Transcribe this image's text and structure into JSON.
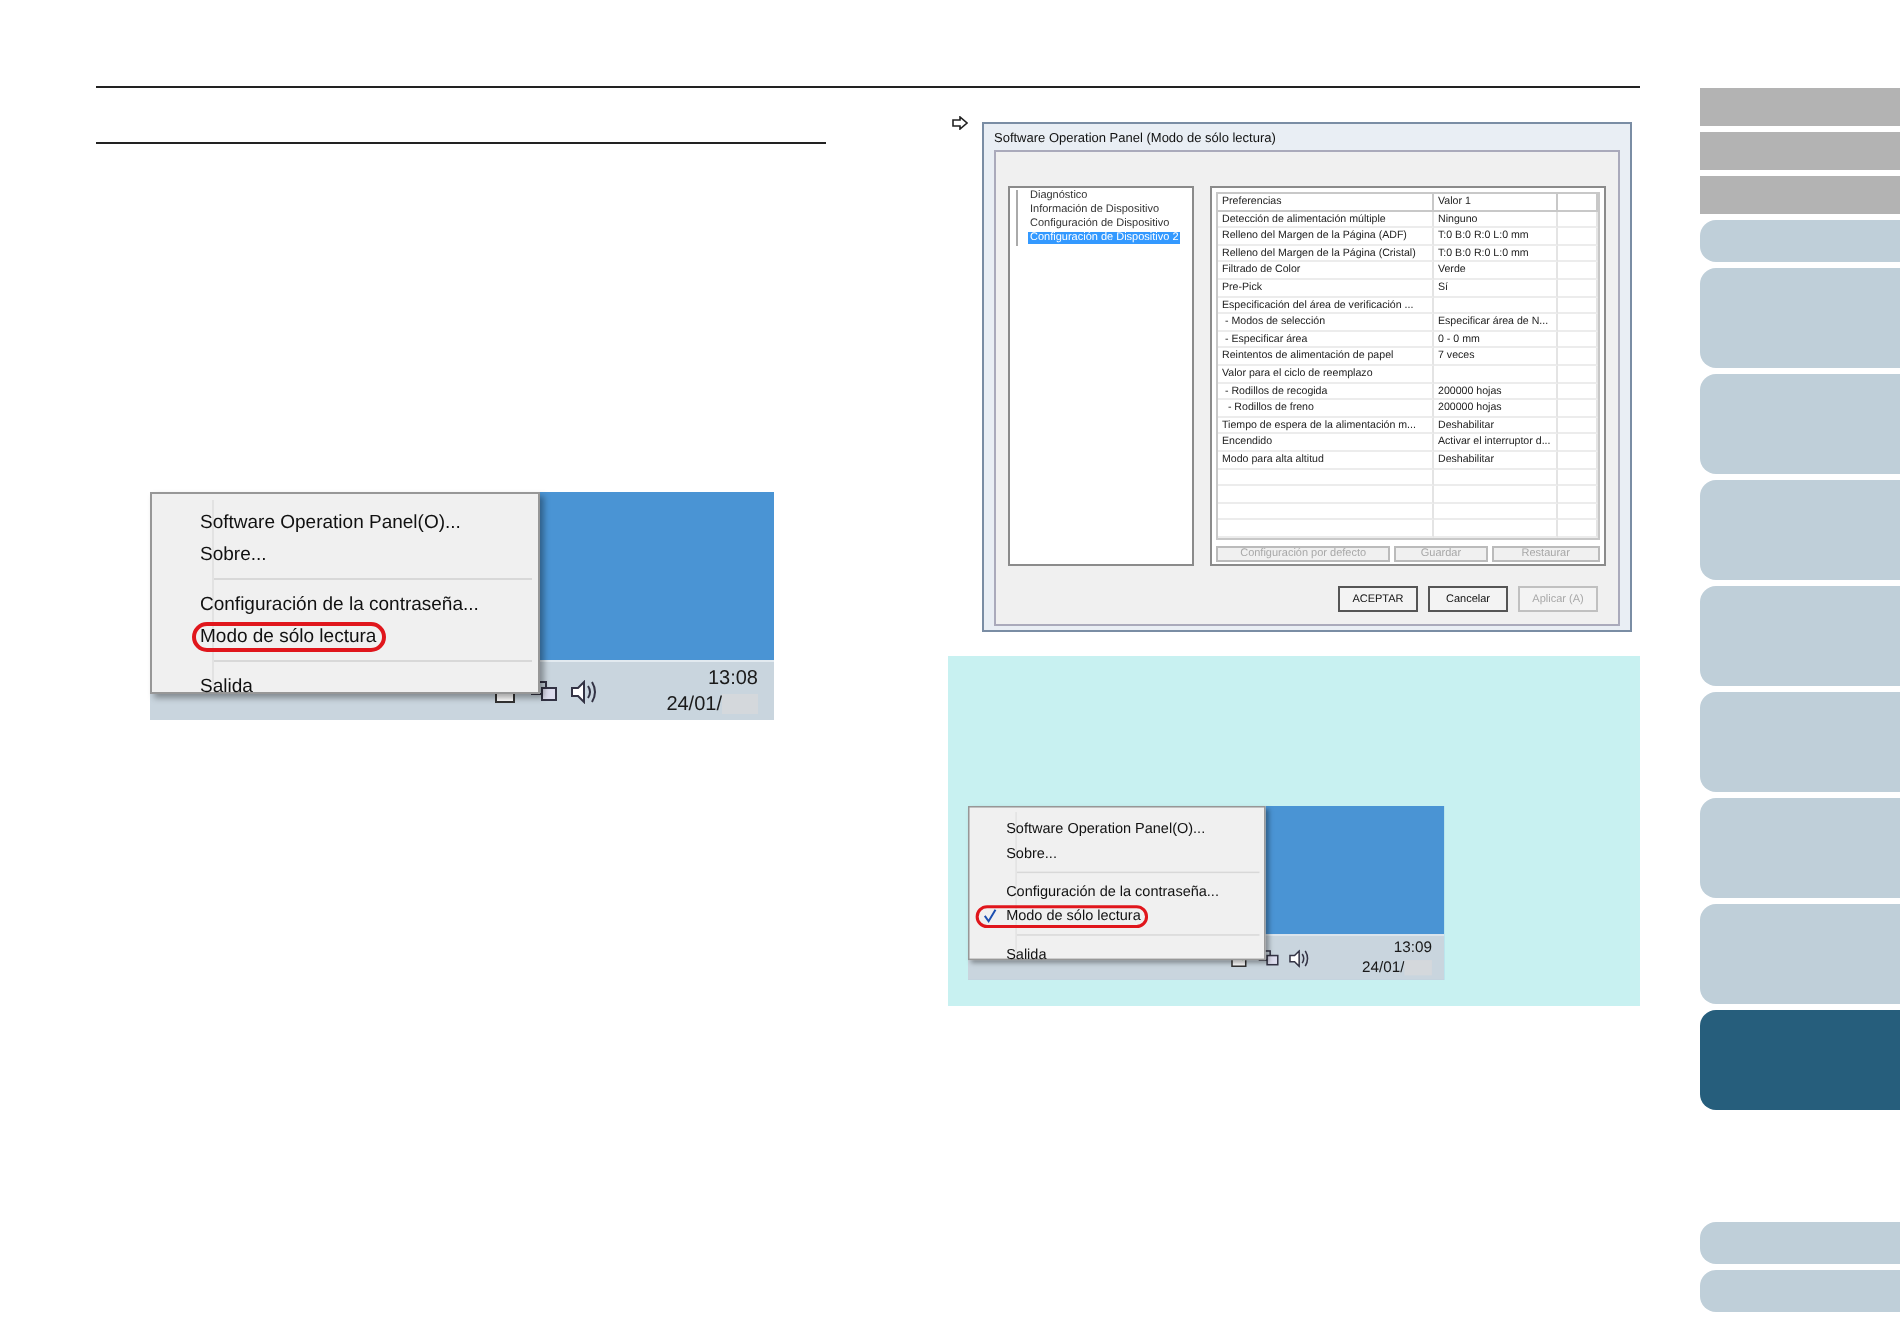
{
  "side_tabs": [
    {
      "kind": "bar",
      "selected": false
    },
    {
      "kind": "bar",
      "selected": false
    },
    {
      "kind": "bar",
      "selected": false
    },
    {
      "kind": "short",
      "selected": false
    },
    {
      "kind": "tall",
      "selected": false
    },
    {
      "kind": "tall",
      "selected": false
    },
    {
      "kind": "tall",
      "selected": false
    },
    {
      "kind": "tall",
      "selected": false
    },
    {
      "kind": "tall",
      "selected": false
    },
    {
      "kind": "tall",
      "selected": false
    },
    {
      "kind": "tall",
      "selected": false
    },
    {
      "kind": "tall",
      "selected": true
    },
    {
      "kind": "foot",
      "selected": false
    },
    {
      "kind": "short",
      "selected": false
    }
  ],
  "menu_screenshot": {
    "menu_groups": [
      [
        {
          "label": "Software Operation Panel(O)...",
          "circled": false,
          "checked": false
        },
        {
          "label": "Sobre...",
          "circled": false,
          "checked": false
        }
      ],
      [
        {
          "label": "Configuración de la contraseña...",
          "circled": false,
          "checked": false
        },
        {
          "label": "Modo de sólo lectura",
          "circled": true,
          "checked": false
        }
      ],
      [
        {
          "label": "Salida",
          "circled": false,
          "checked": false
        }
      ]
    ],
    "time": "13:08",
    "date": "24/01/"
  },
  "dialog": {
    "title": "Software Operation Panel (Modo de sólo lectura)",
    "tree": [
      {
        "label": "Diagnóstico",
        "selected": false
      },
      {
        "label": "Información de Dispositivo",
        "selected": false
      },
      {
        "label": "Configuración de Dispositivo",
        "selected": false
      },
      {
        "label": "Configuración de Dispositivo 2",
        "selected": true
      }
    ],
    "columns": [
      "Preferencias",
      "Valor 1"
    ],
    "rows": [
      [
        "Detección de alimentación múltiple",
        "Ninguno"
      ],
      [
        "Relleno del Margen de la Página (ADF)",
        "T:0 B:0 R:0 L:0 mm"
      ],
      [
        "Relleno del Margen de la Página (Cristal)",
        "T:0 B:0 R:0 L:0 mm"
      ],
      [
        "Filtrado de Color",
        "Verde"
      ],
      [
        "Pre-Pick",
        "Sí"
      ],
      [
        "Especificación del área de verificación ..."
      ],
      [
        " - Modos de selección",
        "Especificar área de N..."
      ],
      [
        " - Especificar área",
        "0 - 0 mm"
      ],
      [
        "Reintentos de alimentación de papel",
        "7 veces"
      ],
      [
        "Valor para el ciclo de reemplazo"
      ],
      [
        " - Rodillos de recogida",
        "200000 hojas"
      ],
      [
        "  - Rodillos de freno",
        "200000 hojas"
      ],
      [
        "Tiempo de espera de la alimentación m...",
        "Deshabilitar"
      ],
      [
        "Encendido",
        "Activar el interruptor d..."
      ],
      [
        "Modo para alta altitud",
        "Deshabilitar"
      ]
    ],
    "panel_buttons": [
      {
        "label": "Configuración por defecto",
        "disabled": true
      },
      {
        "label": "Guardar",
        "disabled": true
      },
      {
        "label": "Restaurar",
        "disabled": true
      }
    ],
    "buttons": [
      {
        "label": "ACEPTAR",
        "disabled": false
      },
      {
        "label": "Cancelar",
        "disabled": false
      },
      {
        "label": "Aplicar (A)",
        "disabled": true
      }
    ]
  },
  "note_screenshot": {
    "menu_groups": [
      [
        {
          "label": "Software Operation Panel(O)...",
          "circled": false,
          "checked": false
        },
        {
          "label": "Sobre...",
          "circled": false,
          "checked": false
        }
      ],
      [
        {
          "label": "Configuración de la contraseña...",
          "circled": false,
          "checked": false
        },
        {
          "label": "Modo de sólo lectura",
          "circled": true,
          "checked": true
        }
      ],
      [
        {
          "label": "Salida",
          "circled": false,
          "checked": false
        }
      ]
    ],
    "time": "13:09",
    "date": "24/01/"
  }
}
